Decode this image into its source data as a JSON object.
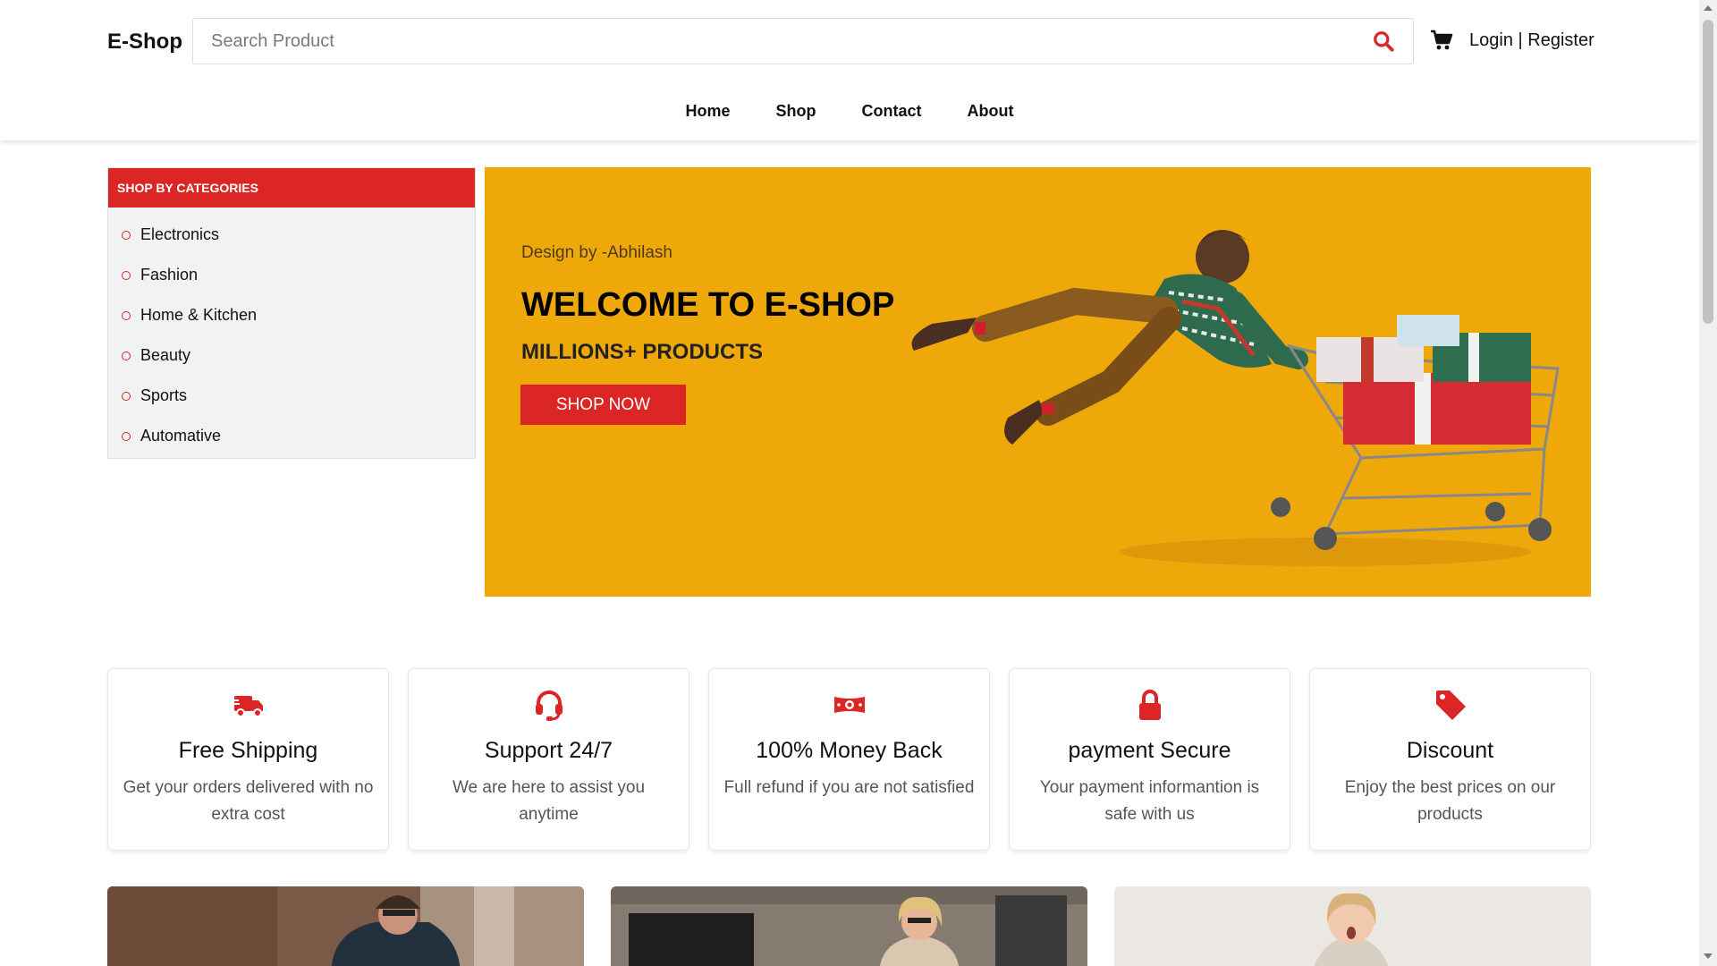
{
  "header": {
    "logo": "E-Shop",
    "search_placeholder": "Search Product",
    "auth_login": "Login",
    "auth_separator": " | ",
    "auth_register": "Register"
  },
  "nav": {
    "items": [
      "Home",
      "Shop",
      "Contact",
      "About"
    ]
  },
  "categories": {
    "title": "SHOP BY CATEGORIES",
    "items": [
      "Electronics",
      "Fashion",
      "Home & Kitchen",
      "Beauty",
      "Sports",
      "Automative"
    ]
  },
  "hero": {
    "credit": "Design by -Abhilash",
    "title": "WELCOME TO E-SHOP",
    "subtitle": "MILLIONS+ PRODUCTS",
    "cta": "SHOP NOW"
  },
  "features": [
    {
      "icon": "truck-icon",
      "title": "Free Shipping",
      "desc": "Get your orders delivered with no extra cost"
    },
    {
      "icon": "headset-icon",
      "title": "Support 24/7",
      "desc": "We are here to assist you anytime"
    },
    {
      "icon": "money-icon",
      "title": "100% Money Back",
      "desc": "Full refund if you are not satisfied"
    },
    {
      "icon": "lock-icon",
      "title": "payment Secure",
      "desc": "Your payment informantion is safe with us"
    },
    {
      "icon": "tag-icon",
      "title": "Discount",
      "desc": "Enjoy the best prices on our products"
    }
  ],
  "colors": {
    "accent": "#dc2626",
    "hero_bg": "#efa80a",
    "category_bg": "#f1f2f4"
  }
}
